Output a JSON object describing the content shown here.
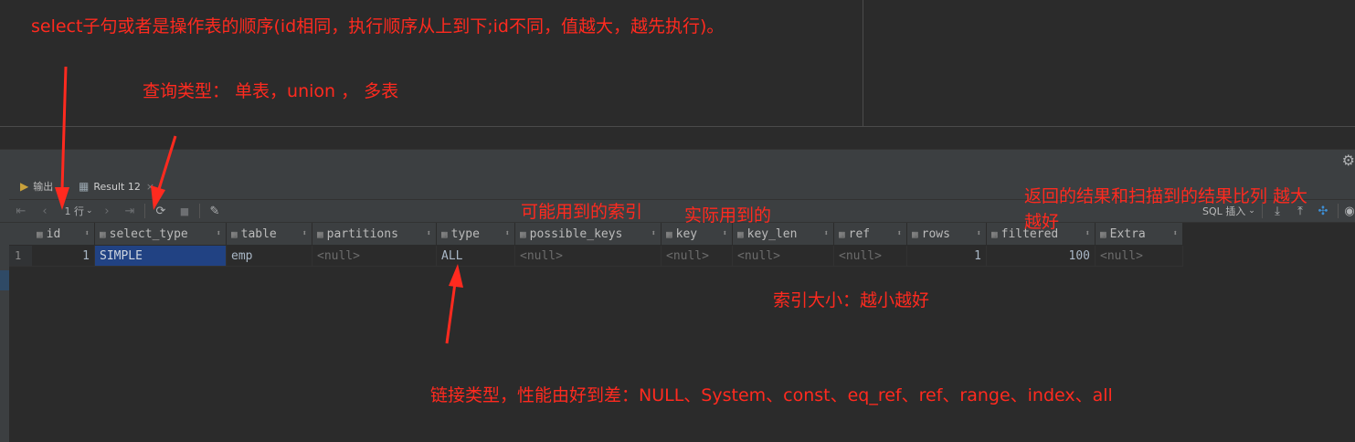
{
  "annotations": {
    "select_note": "select子句或者是操作表的顺序(id相同，执行顺序从上到下;id不同，值越大，越先执行)。",
    "query_type": "查询类型： 单表，union ， 多表",
    "possible_keys_note": "可能用到的索引",
    "actual_key_note": "实际用到的",
    "filtered_note_line1": "返回的结果和扫描到的结果比列 越大",
    "filtered_note_line2": "越好",
    "key_len_note": "索引大小：越小越好",
    "join_type_note": "链接类型，性能由好到差：NULL、System、const、eq_ref、ref、range、index、all"
  },
  "tabs": [
    {
      "label": "输出",
      "icon": "output-icon"
    },
    {
      "label": "Result 12",
      "icon": "table-icon",
      "close": "×"
    }
  ],
  "toolbar": {
    "row_count": "1 行",
    "sql_mode": "SQL 插入"
  },
  "columns": [
    "id",
    "select_type",
    "table",
    "partitions",
    "type",
    "possible_keys",
    "key",
    "key_len",
    "ref",
    "rows",
    "filtered",
    "Extra"
  ],
  "rows": [
    {
      "rownum": "1",
      "id": "1",
      "select_type": "SIMPLE",
      "table": "emp",
      "partitions": "<null>",
      "type": "ALL",
      "possible_keys": "<null>",
      "key": "<null>",
      "key_len": "<null>",
      "ref": "<null>",
      "rows": "1",
      "filtered": "100",
      "Extra": "<null>"
    }
  ],
  "colors": {
    "background": "#2b2b2b",
    "panel": "#3c3f41",
    "annotation": "#ff2a1f",
    "selected_cell": "#214283"
  }
}
